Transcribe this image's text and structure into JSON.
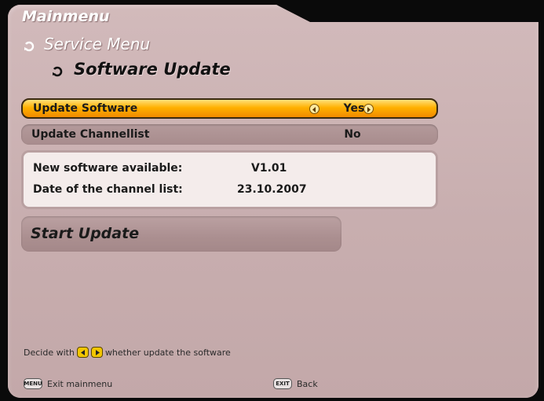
{
  "breadcrumb": {
    "level1": "Mainmenu",
    "level2": "Service Menu",
    "level3": "Software Update",
    "arrow_icon": "arrow-return-icon"
  },
  "options": [
    {
      "label": "Update Software",
      "value": "Yes",
      "selected": true
    },
    {
      "label": "Update Channellist",
      "value": "No",
      "selected": false
    }
  ],
  "info": {
    "new_software_label": "New software available:",
    "new_software_value": "V1.01",
    "channel_list_date_label": "Date of the channel list:",
    "channel_list_date_value": "23.10.2007"
  },
  "start_update_label": "Start Update",
  "help": {
    "prefix": "Decide with",
    "suffix": "whether update the software",
    "icons": [
      "left-arrow-key-icon",
      "right-arrow-key-icon"
    ]
  },
  "footer": {
    "menu_key": "MENU",
    "menu_label": "Exit mainmenu",
    "exit_key": "EXIT",
    "exit_label": "Back"
  },
  "colors": {
    "panel": "#c8aeaf",
    "selected": "#ffb000",
    "info_bg": "#f4eceb"
  }
}
